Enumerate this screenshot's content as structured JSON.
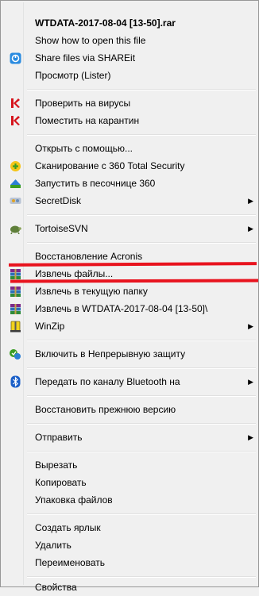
{
  "menu": {
    "items": [
      {
        "label": "WTDATA-2017-08-04 [13-50].rar"
      },
      {
        "label": "Show how to open this file"
      },
      {
        "label": "Share files via SHAREit",
        "icon": "shareit-icon"
      },
      {
        "label": "Просмотр (Lister)"
      },
      {
        "label": "Проверить на вирусы",
        "icon": "kaspersky-icon"
      },
      {
        "label": "Поместить на карантин",
        "icon": "kaspersky-icon"
      },
      {
        "label": "Открыть с помощью..."
      },
      {
        "label": "Сканирование с 360 Total Security",
        "icon": "360-scan-icon"
      },
      {
        "label": "Запустить в песочнице 360",
        "icon": "360-sandbox-icon"
      },
      {
        "label": "SecretDisk",
        "icon": "secretdisk-icon"
      },
      {
        "label": "TortoiseSVN",
        "icon": "tortoisesvn-icon"
      },
      {
        "label": "Восстановление Acronis"
      },
      {
        "label": "Извлечь файлы...",
        "icon": "winrar-icon"
      },
      {
        "label": "Извлечь в текущую папку",
        "icon": "winrar-icon"
      },
      {
        "label": "Извлечь в WTDATA-2017-08-04 [13-50]\\",
        "icon": "winrar-icon"
      },
      {
        "label": "WinZip",
        "icon": "winzip-icon"
      },
      {
        "label": "Включить в Непрерывную защиту",
        "icon": "acronis-protect-icon"
      },
      {
        "label": "Передать по каналу Bluetooth на",
        "icon": "bluetooth-icon"
      },
      {
        "label": "Восстановить прежнюю версию"
      },
      {
        "label": "Отправить"
      },
      {
        "label": "Вырезать"
      },
      {
        "label": "Копировать"
      },
      {
        "label": "Упаковка файлов"
      },
      {
        "label": "Создать ярлык"
      },
      {
        "label": "Удалить"
      },
      {
        "label": "Переименовать"
      },
      {
        "label": "Свойства"
      }
    ]
  },
  "colors": {
    "menu_background": "#f0f0f0",
    "highlight_mark": "#e8131e",
    "kaspersky": "#d6141c",
    "bluetooth": "#1a5fc8",
    "shareit": "#2a8be0"
  }
}
